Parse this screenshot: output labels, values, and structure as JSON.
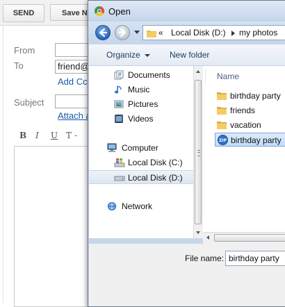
{
  "compose": {
    "send_label": "SEND",
    "save_label": "Save N",
    "from_label": "From",
    "to_label": "To",
    "to_value": "friend@",
    "add_cc_label": "Add Cc",
    "subject_label": "Subject",
    "attach_label": "Attach a",
    "format_buttons": [
      "B",
      "I",
      "U",
      "T",
      "-"
    ]
  },
  "dialog": {
    "title": "Open",
    "address": {
      "overflow": "«",
      "crumbs": [
        "Local Disk (D:)",
        "my photos"
      ]
    },
    "toolbar": {
      "organize_label": "Organize",
      "new_folder_label": "New folder"
    },
    "nav": {
      "libraries": [
        "Documents",
        "Music",
        "Pictures",
        "Videos"
      ],
      "computer_label": "Computer",
      "drives": [
        "Local Disk (C:)",
        "Local Disk (D:)"
      ],
      "network_label": "Network"
    },
    "files": {
      "column_name": "Name",
      "items": [
        "birthday party",
        "friends",
        "vacation",
        "birthday party"
      ]
    },
    "filename_label": "File name:",
    "filename_value": "birthday party"
  },
  "colors": {
    "selection": "#c1dcfc",
    "link": "#1a5aa8",
    "folder": "#e8b94a"
  }
}
